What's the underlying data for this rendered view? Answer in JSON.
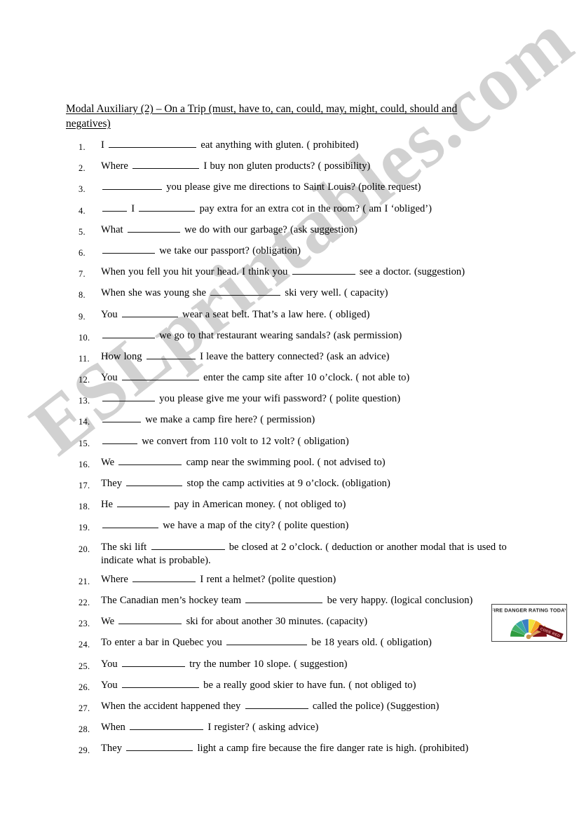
{
  "document": {
    "title": "Modal Auxiliary (2) – On a Trip (must, have to, can, could, may, might, could, should and negatives)",
    "watermark": "ESLprintables.com"
  },
  "questions": [
    {
      "num": "1.",
      "text": "I _________________________ eat anything with gluten. ( prohibited)"
    },
    {
      "num": "2.",
      "text": "Where ___________________ I buy non gluten products? ( possibility)"
    },
    {
      "num": "3.",
      "text": "_________________ you please give me directions to Saint Louis? (polite request)"
    },
    {
      "num": "4.",
      "text": "_______ I ________________ pay extra for an extra cot in the room? ( am I ‘obliged’)"
    },
    {
      "num": "5.",
      "text": "What _______________ we do with our garbage?   (ask suggestion)"
    },
    {
      "num": "6.",
      "text": "_______________ we take our passport? (obligation)"
    },
    {
      "num": "7.",
      "text": "When you fell you hit your head. I think you __________________ see a doctor. (suggestion)"
    },
    {
      "num": "8.",
      "text": "When she was young she ____________________ ski very well. ( capacity)"
    },
    {
      "num": "9.",
      "text": "You ________________ wear a seat belt. That’s a law here. ( obliged)"
    },
    {
      "num": "10.",
      "text": "_______________ we go to that restaurant wearing sandals? (ask permission)"
    },
    {
      "num": "11.",
      "text": "How long ______________ I leave the battery connected? (ask an advice)"
    },
    {
      "num": "12.",
      "text": "You ______________________ enter the camp site after 10 o’clock. ( not able to)"
    },
    {
      "num": "13.",
      "text": "_______________ you please give me your wifi password? ( polite question)"
    },
    {
      "num": "14.",
      "text": "___________ we make a camp fire here? ( permission)"
    },
    {
      "num": "15.",
      "text": "__________ we convert from 110 volt to 12 volt? ( obligation)"
    },
    {
      "num": "16.",
      "text": "We __________________ camp near the swimming pool. ( not advised to)"
    },
    {
      "num": "17.",
      "text": "They ________________ stop the camp activities at 9 o’clock.  (obligation)"
    },
    {
      "num": "18.",
      "text": "He _______________ pay in American money. ( not obliged to)"
    },
    {
      "num": "19.",
      "text": "________________ we have a map of the city? ( polite question)"
    },
    {
      "num": "20.",
      "text": "The ski lift _____________________ be closed at 2 o’clock. ( deduction or another modal that is used to indicate what is probable)."
    },
    {
      "num": "21.",
      "text": "Where __________________ I rent a helmet? (polite question)"
    },
    {
      "num": "22.",
      "text": "The Canadian men’s hockey team ______________________ be very happy. (logical conclusion)"
    },
    {
      "num": "23.",
      "text": "We __________________ ski for about another 30 minutes. (capacity)"
    },
    {
      "num": "24.",
      "text": "To enter a bar in Quebec you _______________________ be 18 years old. ( obligation)"
    },
    {
      "num": "25.",
      "text": "You __________________ try the number 10 slope. ( suggestion)"
    },
    {
      "num": "26.",
      "text": "You ______________________ be a really good skier to have fun. ( not obliged to)"
    },
    {
      "num": "27.",
      "text": "When the accident happened they __________________ called the police) (Suggestion)"
    },
    {
      "num": "28.",
      "text": "When _____________________ I register? ( asking advice)"
    },
    {
      "num": "29.",
      "text": "They ___________________ light a camp fire because the fire danger rate is high. (prohibited)"
    }
  ],
  "figure": {
    "name": "fire-danger-rating-gauge",
    "heading": "FIRE DANGER RATING TODAY",
    "pointer_label": "CODE RED",
    "segment_colors": [
      "#2e9b3e",
      "#43b06a",
      "#3aa9a2",
      "#3b7fc4",
      "#f2e23a",
      "#f4a623",
      "#e8432b",
      "#7c1018"
    ],
    "background": "#ffffff",
    "heading_color": "#222222"
  }
}
